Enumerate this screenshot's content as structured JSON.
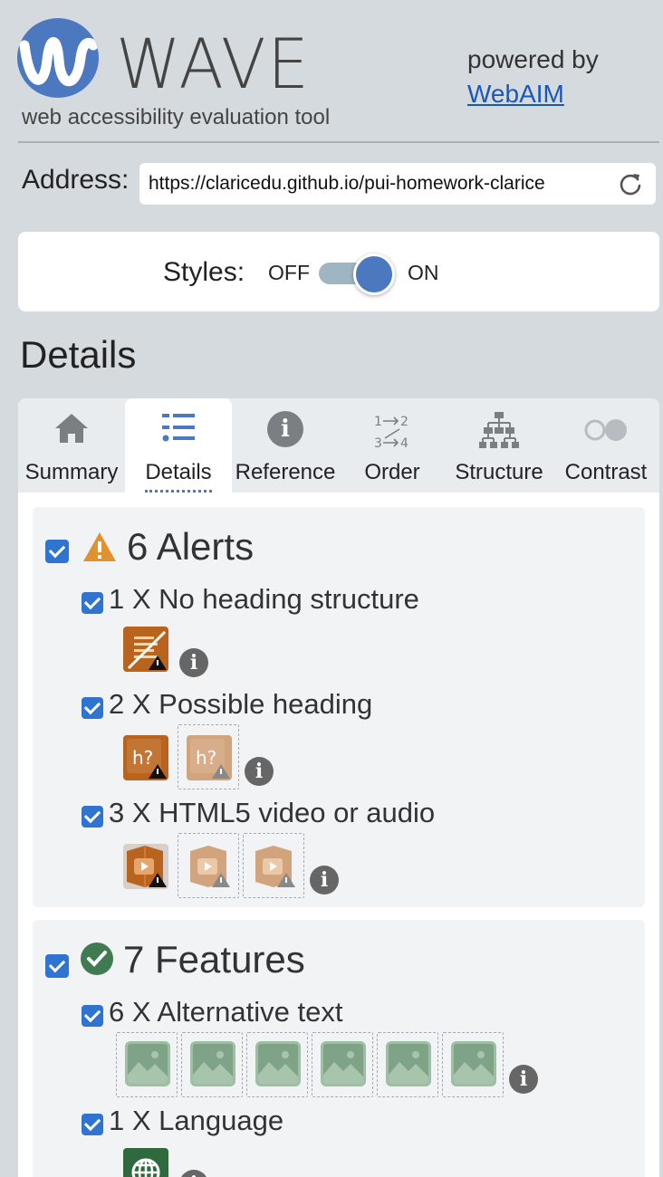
{
  "header": {
    "logo_text": "WAVE",
    "subtitle": "web accessibility evaluation tool",
    "powered_by": "powered by",
    "powered_link": "WebAIM"
  },
  "address": {
    "label": "Address:",
    "value": "https://claricedu.github.io/pui-homework-clarice"
  },
  "styles": {
    "label": "Styles:",
    "off": "OFF",
    "on": "ON",
    "state": "on"
  },
  "details_title": "Details",
  "tabs": [
    {
      "label": "Summary",
      "icon": "home-icon"
    },
    {
      "label": "Details",
      "icon": "list-icon",
      "active": true
    },
    {
      "label": "Reference",
      "icon": "info-icon"
    },
    {
      "label": "Order",
      "icon": "order-icon"
    },
    {
      "label": "Structure",
      "icon": "structure-icon"
    },
    {
      "label": "Contrast",
      "icon": "contrast-icon"
    }
  ],
  "alerts": {
    "title": "6 Alerts",
    "items": [
      {
        "label": "1 X No heading structure",
        "count": 1
      },
      {
        "label": "2 X Possible heading",
        "count": 2
      },
      {
        "label": "3 X HTML5 video or audio",
        "count": 3
      }
    ]
  },
  "features": {
    "title": "7 Features",
    "items": [
      {
        "label": "6 X Alternative text",
        "count": 6
      },
      {
        "label": "1 X Language",
        "count": 1
      }
    ]
  },
  "colors": {
    "accent": "#4b78bf",
    "alert_orange": "#b8641f",
    "feature_green": "#3f7a50",
    "checkbox": "#2f74d0"
  }
}
